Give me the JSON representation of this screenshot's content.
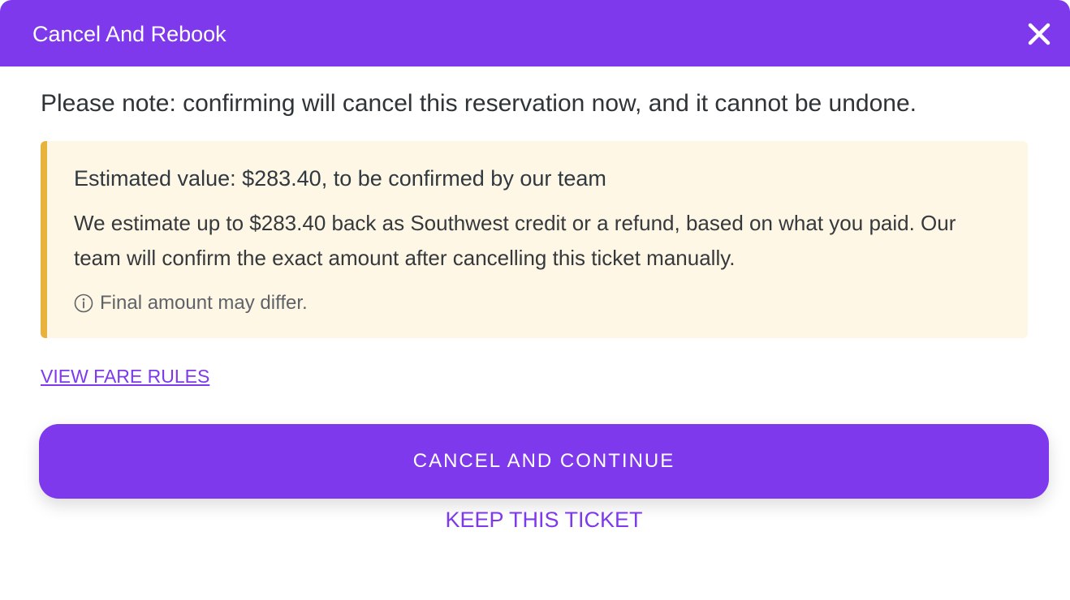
{
  "header": {
    "title": "Cancel And Rebook",
    "close_icon": "close-icon"
  },
  "notice": {
    "text": "Please note: confirming will cancel this reservation now, and it cannot be undone."
  },
  "estimate": {
    "title": "Estimated value: $283.40, to be confirmed by our team",
    "description": "We estimate up to $283.40 back as Southwest credit or a refund, based on what you paid. Our team will confirm the exact amount after cancelling this ticket manually.",
    "note": "Final amount may differ.",
    "note_icon": "info-icon"
  },
  "links": {
    "fare_rules": "VIEW FARE RULES"
  },
  "actions": {
    "primary_label": "CANCEL AND CONTINUE",
    "secondary_label": "KEEP THIS TICKET"
  },
  "colors": {
    "brand": "#7f39ec",
    "warning_border": "#e8b33c",
    "warning_bg": "#fff7e5"
  }
}
